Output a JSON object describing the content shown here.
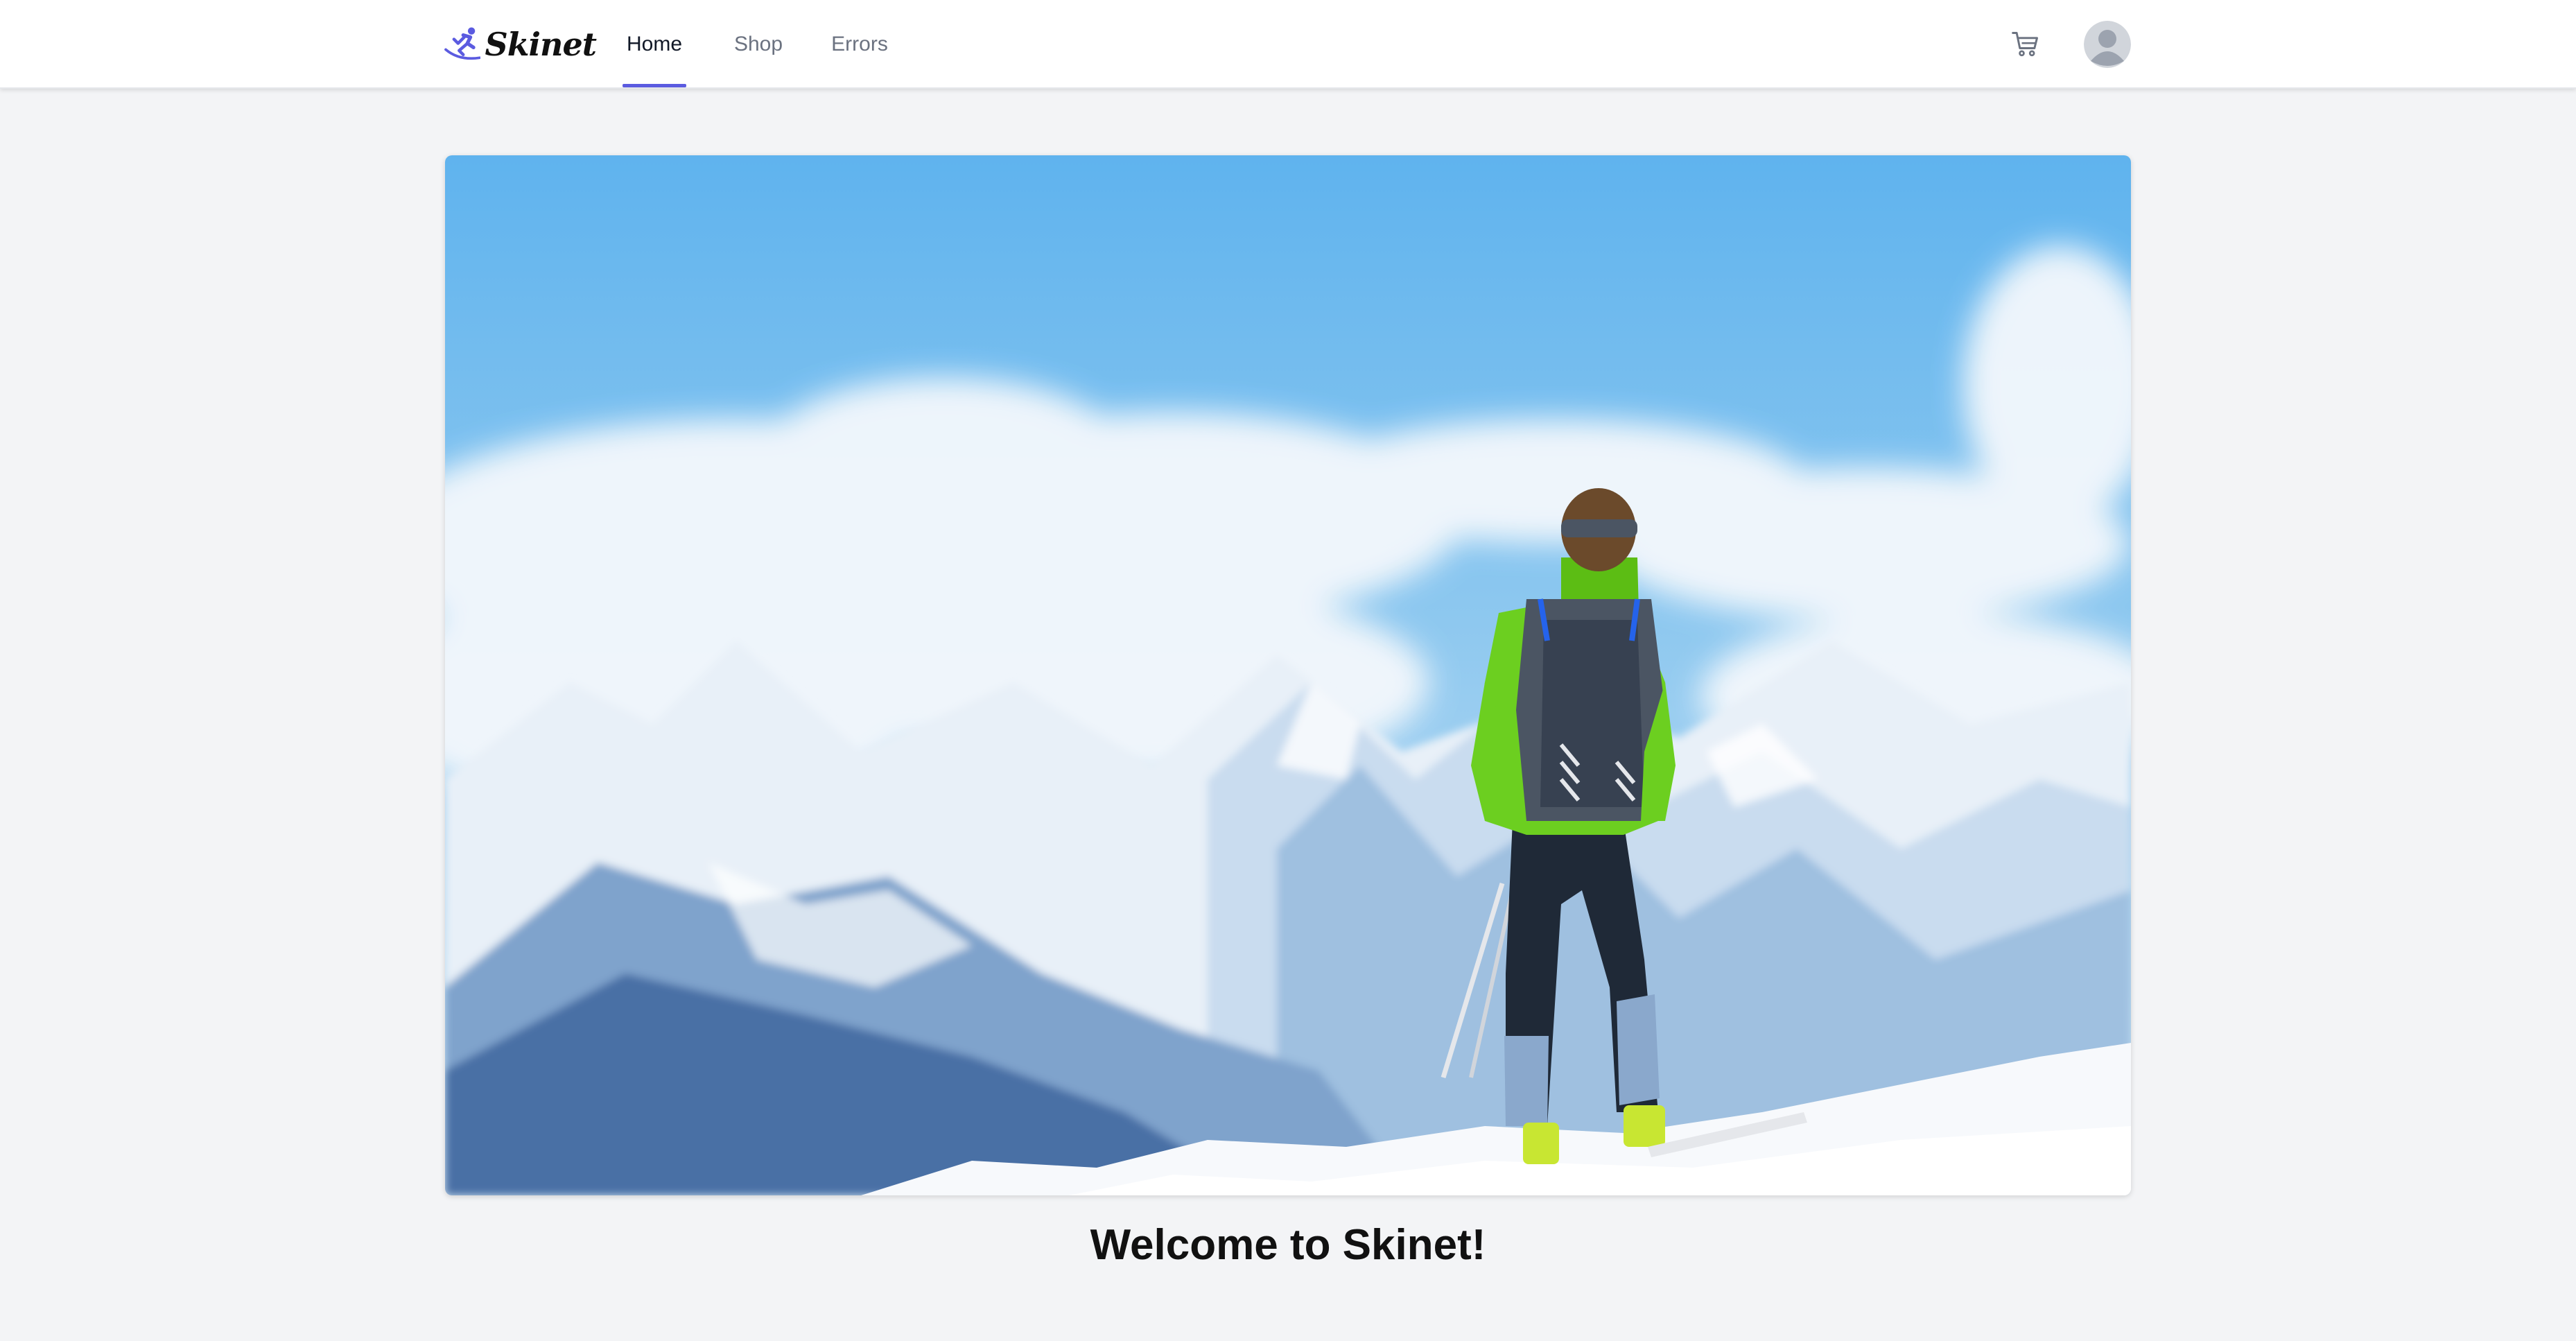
{
  "app": {
    "logo_text": "Skinet"
  },
  "nav": {
    "items": [
      {
        "label": "Home",
        "active": true
      },
      {
        "label": "Shop",
        "active": false
      },
      {
        "label": "Errors",
        "active": false
      }
    ]
  },
  "header_actions": {
    "cart_icon": "cart-icon",
    "avatar_icon": "user-avatar-icon"
  },
  "hero": {
    "image_subject": "skier-on-mountain-summit-photo"
  },
  "main": {
    "welcome_text": "Welcome to Skinet!"
  },
  "colors": {
    "accent": "#5b5be0",
    "page_background": "#f3f4f6",
    "header_background": "#ffffff",
    "nav_active_text": "#111827",
    "nav_inactive_text": "#6b7280"
  }
}
